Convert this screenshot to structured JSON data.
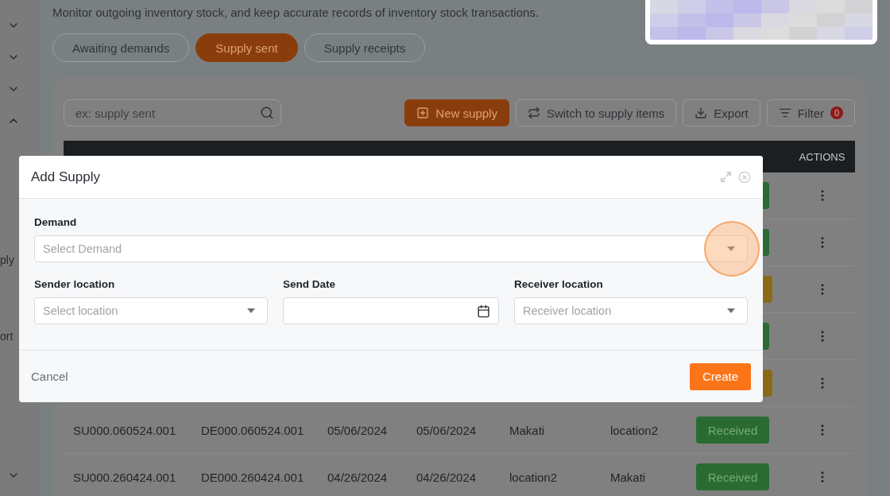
{
  "sidebar": {
    "items": [
      {
        "kind": "toggle",
        "expanded": false
      },
      {
        "kind": "toggle",
        "expanded": false
      },
      {
        "kind": "toggle",
        "expanded": false
      },
      {
        "kind": "toggle",
        "expanded": true
      },
      {
        "kind": "label",
        "label": "ply"
      },
      {
        "kind": "label",
        "label": "ort"
      },
      {
        "kind": "toggle",
        "expanded": false
      }
    ]
  },
  "description": "Monitor outgoing inventory stock, and keep accurate records of inventory stock transactions.",
  "tabs": [
    {
      "label": "Awaiting demands",
      "selected": false
    },
    {
      "label": "Supply sent",
      "selected": true
    },
    {
      "label": "Supply receipts",
      "selected": false
    }
  ],
  "toolbar": {
    "search": {
      "placeholder": "ex: supply sent"
    },
    "buttons": [
      {
        "kind": "primary",
        "label": "New supply"
      },
      {
        "kind": "switch",
        "label": "Switch to supply items"
      },
      {
        "kind": "export",
        "label": "Export"
      },
      {
        "kind": "filter",
        "label": "Filter",
        "badge": "0"
      }
    ]
  },
  "table": {
    "actions_column": "ACTIONS",
    "rows": [
      {
        "status": {
          "color": "#2a6b33"
        }
      },
      {
        "status": {
          "color": "#2a6b33"
        }
      },
      {
        "status": {
          "color": "#8a6a1a"
        }
      },
      {
        "status": {
          "color": "#2a6b33"
        }
      },
      {
        "status": {
          "color": "#8a6a1a"
        }
      },
      {
        "supply_no": "SU000.060524.001",
        "demand_no": "DE000.060524.001",
        "send_date": "05/06/2024",
        "received_date": "05/06/2024",
        "from_location": "Makati",
        "to_location": "location2",
        "status": {
          "label": "Received",
          "color": "#2a6b33"
        }
      },
      {
        "supply_no": "SU000.260424.001",
        "demand_no": "DE000.260424.001",
        "send_date": "04/26/2024",
        "received_date": "04/26/2024",
        "from_location": "location2",
        "to_location": "Makati",
        "status": {
          "label": "Received",
          "color": "#2a6b33"
        }
      }
    ]
  },
  "modal": {
    "title": "Add Supply",
    "demand": {
      "kind": "select",
      "label": "Demand",
      "placeholder": "Select Demand"
    },
    "fields": [
      {
        "kind": "select",
        "label": "Sender location",
        "placeholder": "Select location"
      },
      {
        "kind": "date",
        "label": "Send Date"
      },
      {
        "kind": "select",
        "label": "Receiver location",
        "placeholder": "Receiver location"
      }
    ],
    "highlight": {
      "kind": "click"
    },
    "cancel": "Cancel",
    "submit": "Create"
  }
}
